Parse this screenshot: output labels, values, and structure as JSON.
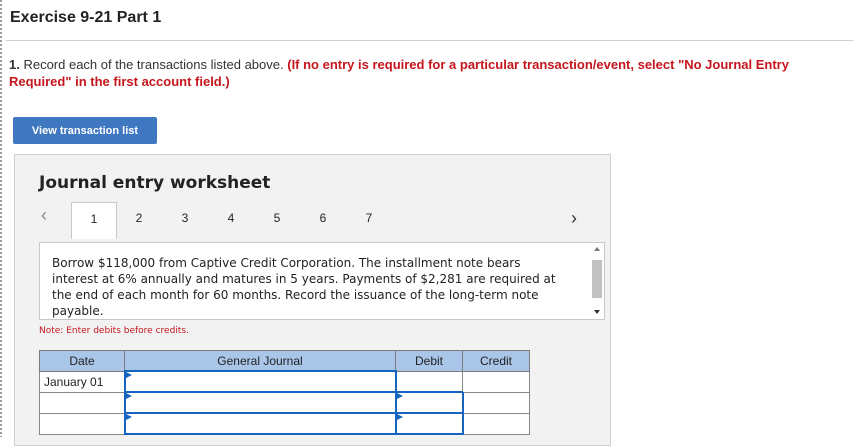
{
  "header": {
    "title": "Exercise 9-21 Part 1"
  },
  "instructions": {
    "number": "1.",
    "text": " Record each of the transactions listed above. ",
    "highlight": "(If no entry is required for a particular transaction/event, select \"No Journal Entry Required\" in the first account field.)"
  },
  "view_button": {
    "label": "View transaction list"
  },
  "worksheet": {
    "title": "Journal entry worksheet",
    "tabs": [
      "1",
      "2",
      "3",
      "4",
      "5",
      "6",
      "7"
    ],
    "active_tab": "1",
    "prev_glyph": "‹",
    "next_glyph": "›",
    "transaction_text": "Borrow $118,000 from Captive Credit Corporation. The installment note bears interest at 6% annually and matures in 5 years. Payments of $2,281 are required at the end of each month for 60 months. Record the issuance of the long-term note payable.",
    "note": "Note: Enter debits before credits.",
    "table": {
      "headers": {
        "date": "Date",
        "journal": "General Journal",
        "debit": "Debit",
        "credit": "Credit"
      },
      "rows": [
        {
          "date": "January 01"
        },
        {
          "date": ""
        },
        {
          "date": ""
        }
      ]
    }
  }
}
